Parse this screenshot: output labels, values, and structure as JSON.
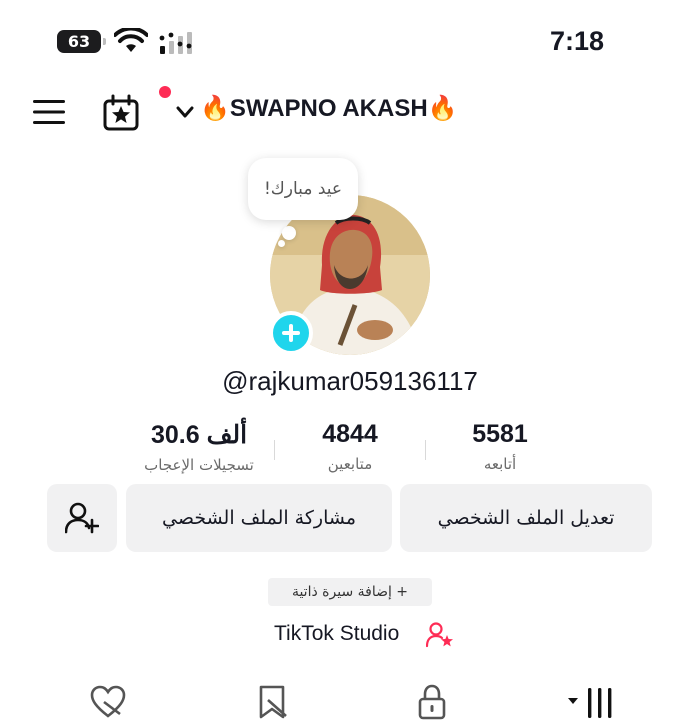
{
  "status_bar": {
    "battery": "63",
    "time": "7:18"
  },
  "header": {
    "title": "🔥SWAPNO AKASH🔥"
  },
  "profile": {
    "bubble_text": "عيد مبارك!",
    "handle": "@rajkumar059136117"
  },
  "stats": [
    {
      "value": "30.6 ألف",
      "label": "تسجيلات الإعجاب"
    },
    {
      "value": "4844",
      "label": "متابعين"
    },
    {
      "value": "5581",
      "label": "أتابعه"
    }
  ],
  "buttons": {
    "share_profile": "مشاركة الملف الشخصي",
    "edit_profile": "تعديل الملف الشخصي"
  },
  "bio": {
    "add_label": "+ إضافة سيرة ذاتية"
  },
  "studio": {
    "label": "TikTok Studio"
  },
  "colors": {
    "accent": "#fe2c55",
    "plus_badge": "#20d5ec"
  },
  "icons": [
    "menu-icon",
    "calendar-star-icon",
    "chevron-down-icon",
    "plus-icon",
    "add-friend-icon",
    "studio-person-star-icon",
    "liked-heart-icon",
    "saved-bookmark-icon",
    "lock-icon",
    "grid-icon"
  ]
}
